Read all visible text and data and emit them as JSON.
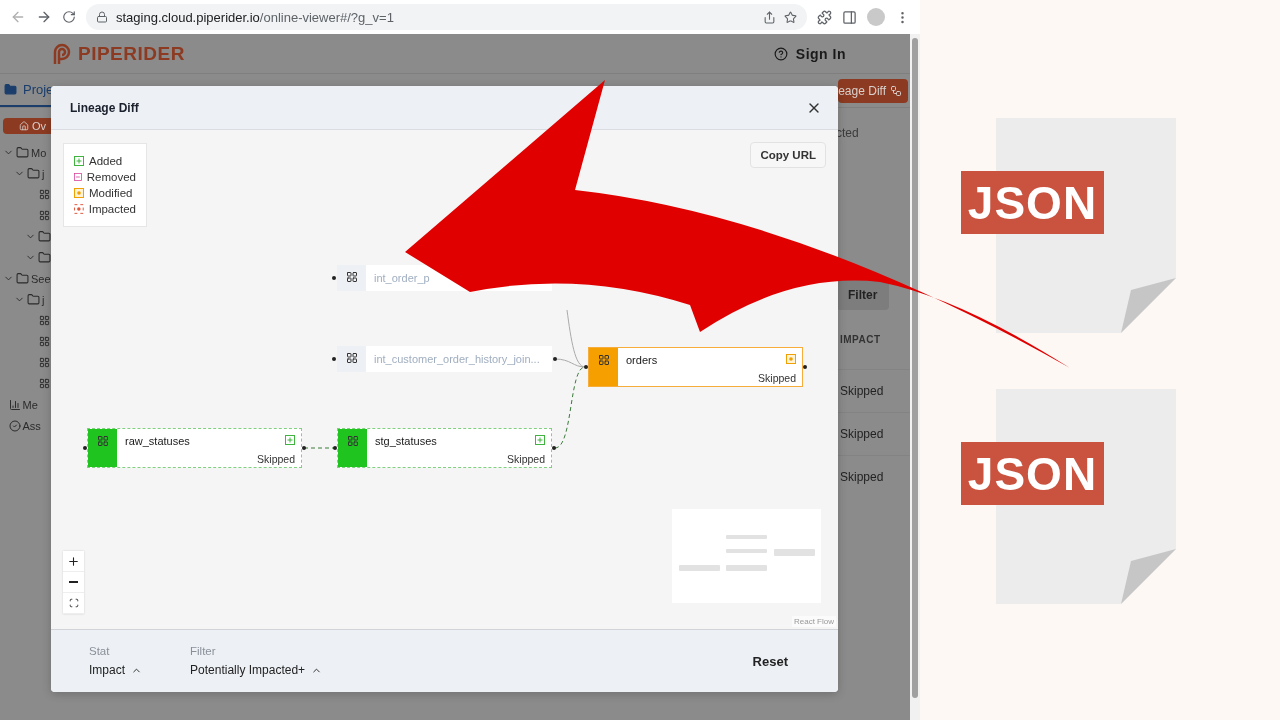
{
  "browser": {
    "url_host": "staging.cloud.piperider.io",
    "url_path": "/online-viewer#/?g_v=1"
  },
  "app": {
    "logo": "PIPERIDER",
    "sign_in": "Sign In",
    "tabs": [
      {
        "label": "Proje",
        "selected": true
      }
    ],
    "lineage_button": "eage Diff",
    "overview_button": "Ov",
    "sidebar": [
      {
        "kind": "folder",
        "label": "Mo",
        "expanded": true,
        "children": [
          {
            "kind": "folder",
            "label": "j",
            "expanded": true,
            "children": [
              {
                "kind": "model"
              },
              {
                "kind": "model"
              },
              {
                "kind": "folder",
                "expanded": true
              },
              {
                "kind": "folder",
                "expanded": true
              }
            ]
          }
        ]
      },
      {
        "kind": "folder",
        "label": "See",
        "expanded": true,
        "children": [
          {
            "kind": "folder",
            "label": "j",
            "expanded": true,
            "children": [
              {
                "kind": "model"
              },
              {
                "kind": "model"
              },
              {
                "kind": "model"
              },
              {
                "kind": "model"
              }
            ]
          }
        ]
      },
      {
        "kind": "metric",
        "label": "Me"
      },
      {
        "kind": "assertion",
        "label": "Ass"
      }
    ],
    "right_column": {
      "text": "cted",
      "filter_button": "Filter",
      "column_header": "IMPACT",
      "cells": [
        "Skipped",
        "Skipped",
        "Skipped"
      ]
    }
  },
  "dialog": {
    "title": "Lineage Diff",
    "copy_url": "Copy URL",
    "legend": [
      {
        "label": "Added",
        "kind": "added"
      },
      {
        "label": "Removed",
        "kind": "removed"
      },
      {
        "label": "Modified",
        "kind": "modified"
      },
      {
        "label": "Impacted",
        "kind": "impacted"
      }
    ],
    "nodes": [
      {
        "name": "int_order_p",
        "kind": "faded"
      },
      {
        "name": "int_customer_order_history_join...",
        "kind": "faded"
      },
      {
        "name": "orders",
        "kind": "modified",
        "status": "Skipped"
      },
      {
        "name": "raw_statuses",
        "kind": "added",
        "status": "Skipped"
      },
      {
        "name": "stg_statuses",
        "kind": "added",
        "status": "Skipped"
      }
    ],
    "attribution": "React Flow",
    "footer": {
      "stat_label": "Stat",
      "stat_value": "Impact",
      "filter_label": "Filter",
      "filter_value": "Potentially Impacted+",
      "reset": "Reset"
    }
  },
  "art": {
    "files": [
      "JSON",
      "JSON"
    ]
  }
}
